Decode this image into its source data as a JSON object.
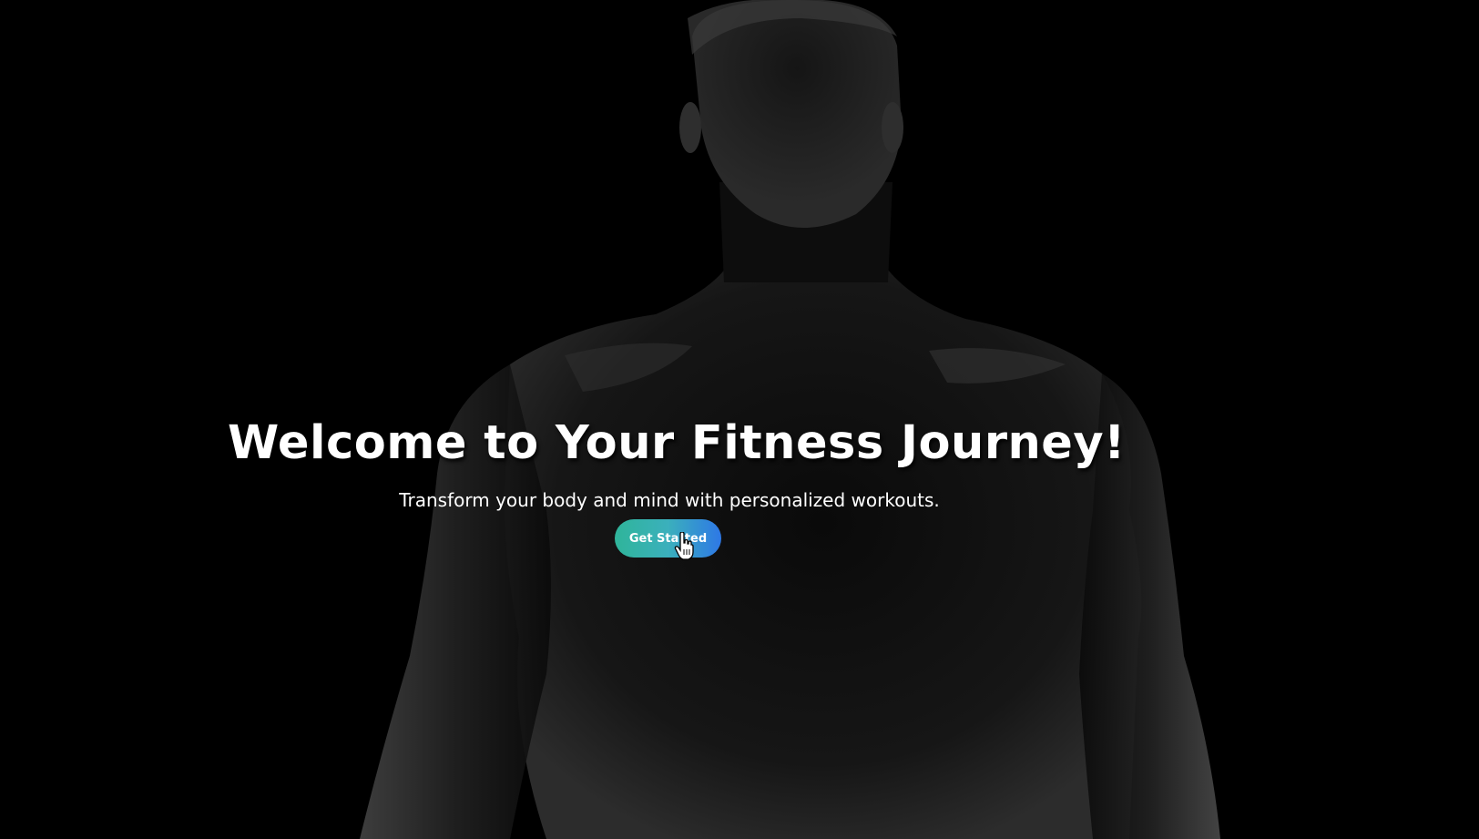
{
  "hero": {
    "title": "Welcome to Your Fitness Journey!",
    "subtitle": "Transform your body and mind with personalized workouts.",
    "cta_label": "Get Started",
    "background_icon": "muscular-man-silhouette-image",
    "cursor_icon": "hand-pointer-cursor-icon"
  },
  "colors": {
    "background": "#000000",
    "text": "#ffffff",
    "cta_gradient_start": "#2fb59a",
    "cta_gradient_end": "#2e78e6"
  }
}
